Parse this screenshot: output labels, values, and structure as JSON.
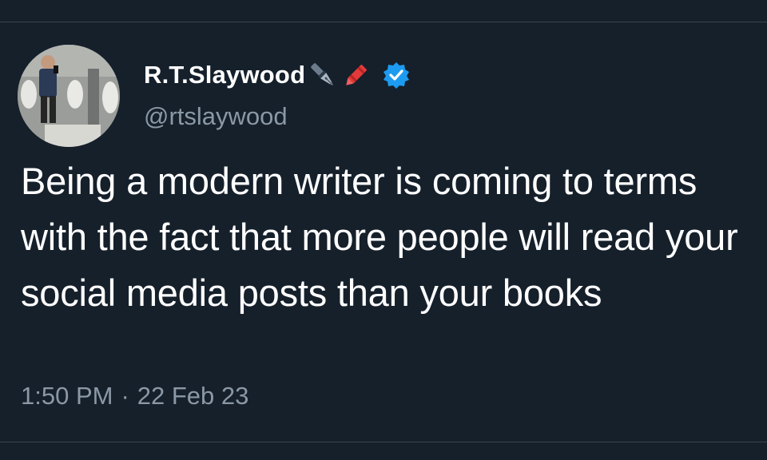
{
  "tweet": {
    "display_name": "R.T.Slaywood",
    "name_emojis": [
      "fountain-pen-emoji",
      "crayon-emoji"
    ],
    "verified_icon": "verified-badge-icon",
    "handle": "@rtslaywood",
    "text": "Being a modern writer is coming to terms with the fact that more people will read your social media posts than your books",
    "time": "1:50 PM",
    "separator": "·",
    "date": "22 Feb 23"
  },
  "colors": {
    "background": "#15202b",
    "text_primary": "#ffffff",
    "text_secondary": "#8b98a5",
    "divider": "#38444d",
    "verified": "#1d9bf0"
  }
}
